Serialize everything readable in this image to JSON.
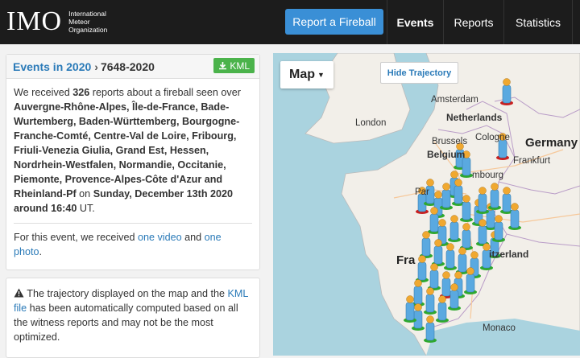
{
  "header": {
    "logo_mark": "IMO",
    "logo_line1": "International",
    "logo_line2": "Meteor",
    "logo_line3": "Organization",
    "report_button": "Report a Fireball",
    "nav": [
      "Events",
      "Reports",
      "Statistics"
    ]
  },
  "event": {
    "breadcrumb_link": "Events in 2020",
    "separator": "›",
    "event_id": "7648-2020",
    "kml_label": "KML",
    "intro": "We received",
    "report_count": "326",
    "intro_tail": "reports about a fireball seen over",
    "regions": "Auvergne-Rhône-Alpes, Île-de-France, Bade-Wurtemberg, Baden-Württemberg, Bourgogne-Franche-Comté, Centre-Val de Loire, Fribourg, Friuli-Venezia Giulia, Grand Est, Hessen, Nordrhein-Westfalen, Normandie, Occitanie, Piemonte, Provence-Alpes-Côte d'Azur and Rheinland-Pf",
    "on_word": "on",
    "date_text": "Sunday, December 13th 2020 around 16:40",
    "tz": "UT.",
    "media_intro": "For this event, we received",
    "video_link": "one video",
    "and_word": "and",
    "photo_link": "one photo",
    "media_end": "."
  },
  "warning": {
    "icon": "warning-icon",
    "text_before": "The trajectory displayed on the map and the",
    "kml_link": "KML file",
    "text_after": "has been automatically computed based on all the witness reports and may not be the most optimized."
  },
  "map": {
    "map_type": "Map",
    "trajectory_button": "Hide Trajectory",
    "labels": {
      "amsterdam": "Amsterdam",
      "netherlands": "Netherlands",
      "london": "London",
      "cologne": "Cologne",
      "germany": "Germany",
      "brussels": "Brussels",
      "belgium": "Belgium",
      "frankfurt": "Frankfurt",
      "luxembourg": "mbourg",
      "paris": "Par",
      "france": "Fra",
      "switzerland": "itzerland",
      "monaco": "Monaco"
    },
    "marker_colors": {
      "body": "#5aa9e0",
      "head": "#f0a830",
      "base_green": "#2ea82e",
      "base_red": "#c82020"
    }
  }
}
